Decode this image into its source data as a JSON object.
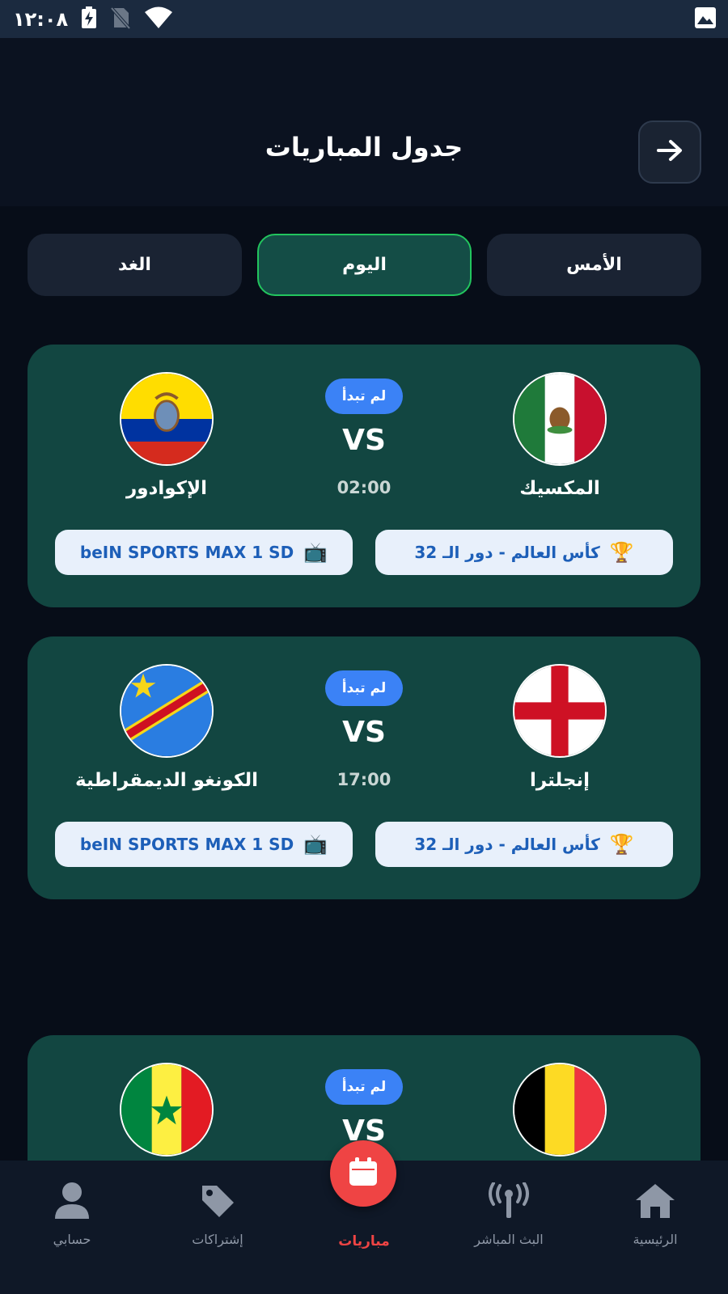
{
  "status_bar": {
    "time": "١٢:٠٨",
    "icons": [
      "battery-charging-icon",
      "no-sim-icon",
      "wifi-icon",
      "image-notification-icon"
    ]
  },
  "header": {
    "title": "جدول المباريات",
    "back_icon": "arrow-right-icon"
  },
  "day_tabs": [
    {
      "label": "الأمس",
      "active": false
    },
    {
      "label": "اليوم",
      "active": true
    },
    {
      "label": "الغد",
      "active": false
    }
  ],
  "matches": [
    {
      "home_team": "المكسيك",
      "away_team": "الإكوادور",
      "home_flag": "mexico-flag",
      "away_flag": "ecuador-flag",
      "status": "لم تبدأ",
      "vs": "VS",
      "time": "02:00",
      "competition": "كأس العالم - دور الـ 32",
      "channel": "beIN SPORTS MAX 1 SD"
    },
    {
      "home_team": "إنجلترا",
      "away_team": "الكونغو الديمقراطية",
      "home_flag": "england-flag",
      "away_flag": "dr-congo-flag",
      "status": "لم تبدأ",
      "vs": "VS",
      "time": "17:00",
      "competition": "كأس العالم - دور الـ 32",
      "channel": "beIN SPORTS MAX 1 SD"
    },
    {
      "home_team": "",
      "away_team": "",
      "home_flag": "belgium-flag",
      "away_flag": "senegal-flag",
      "status": "لم تبدأ",
      "vs": "VS"
    }
  ],
  "bottom_nav": [
    {
      "label": "الرئيسية",
      "icon": "home-icon"
    },
    {
      "label": "البث المباشر",
      "icon": "broadcast-icon"
    },
    {
      "label": "مباريات",
      "icon": "calendar-icon",
      "active": true
    },
    {
      "label": "إشتراكات",
      "icon": "tag-icon"
    },
    {
      "label": "حسابي",
      "icon": "user-icon"
    }
  ],
  "colors": {
    "background": "#070d18",
    "card": "#124641",
    "active_tab_border": "#22c55e",
    "status_pill": "#3b82f6",
    "accent_red": "#ef4444"
  }
}
